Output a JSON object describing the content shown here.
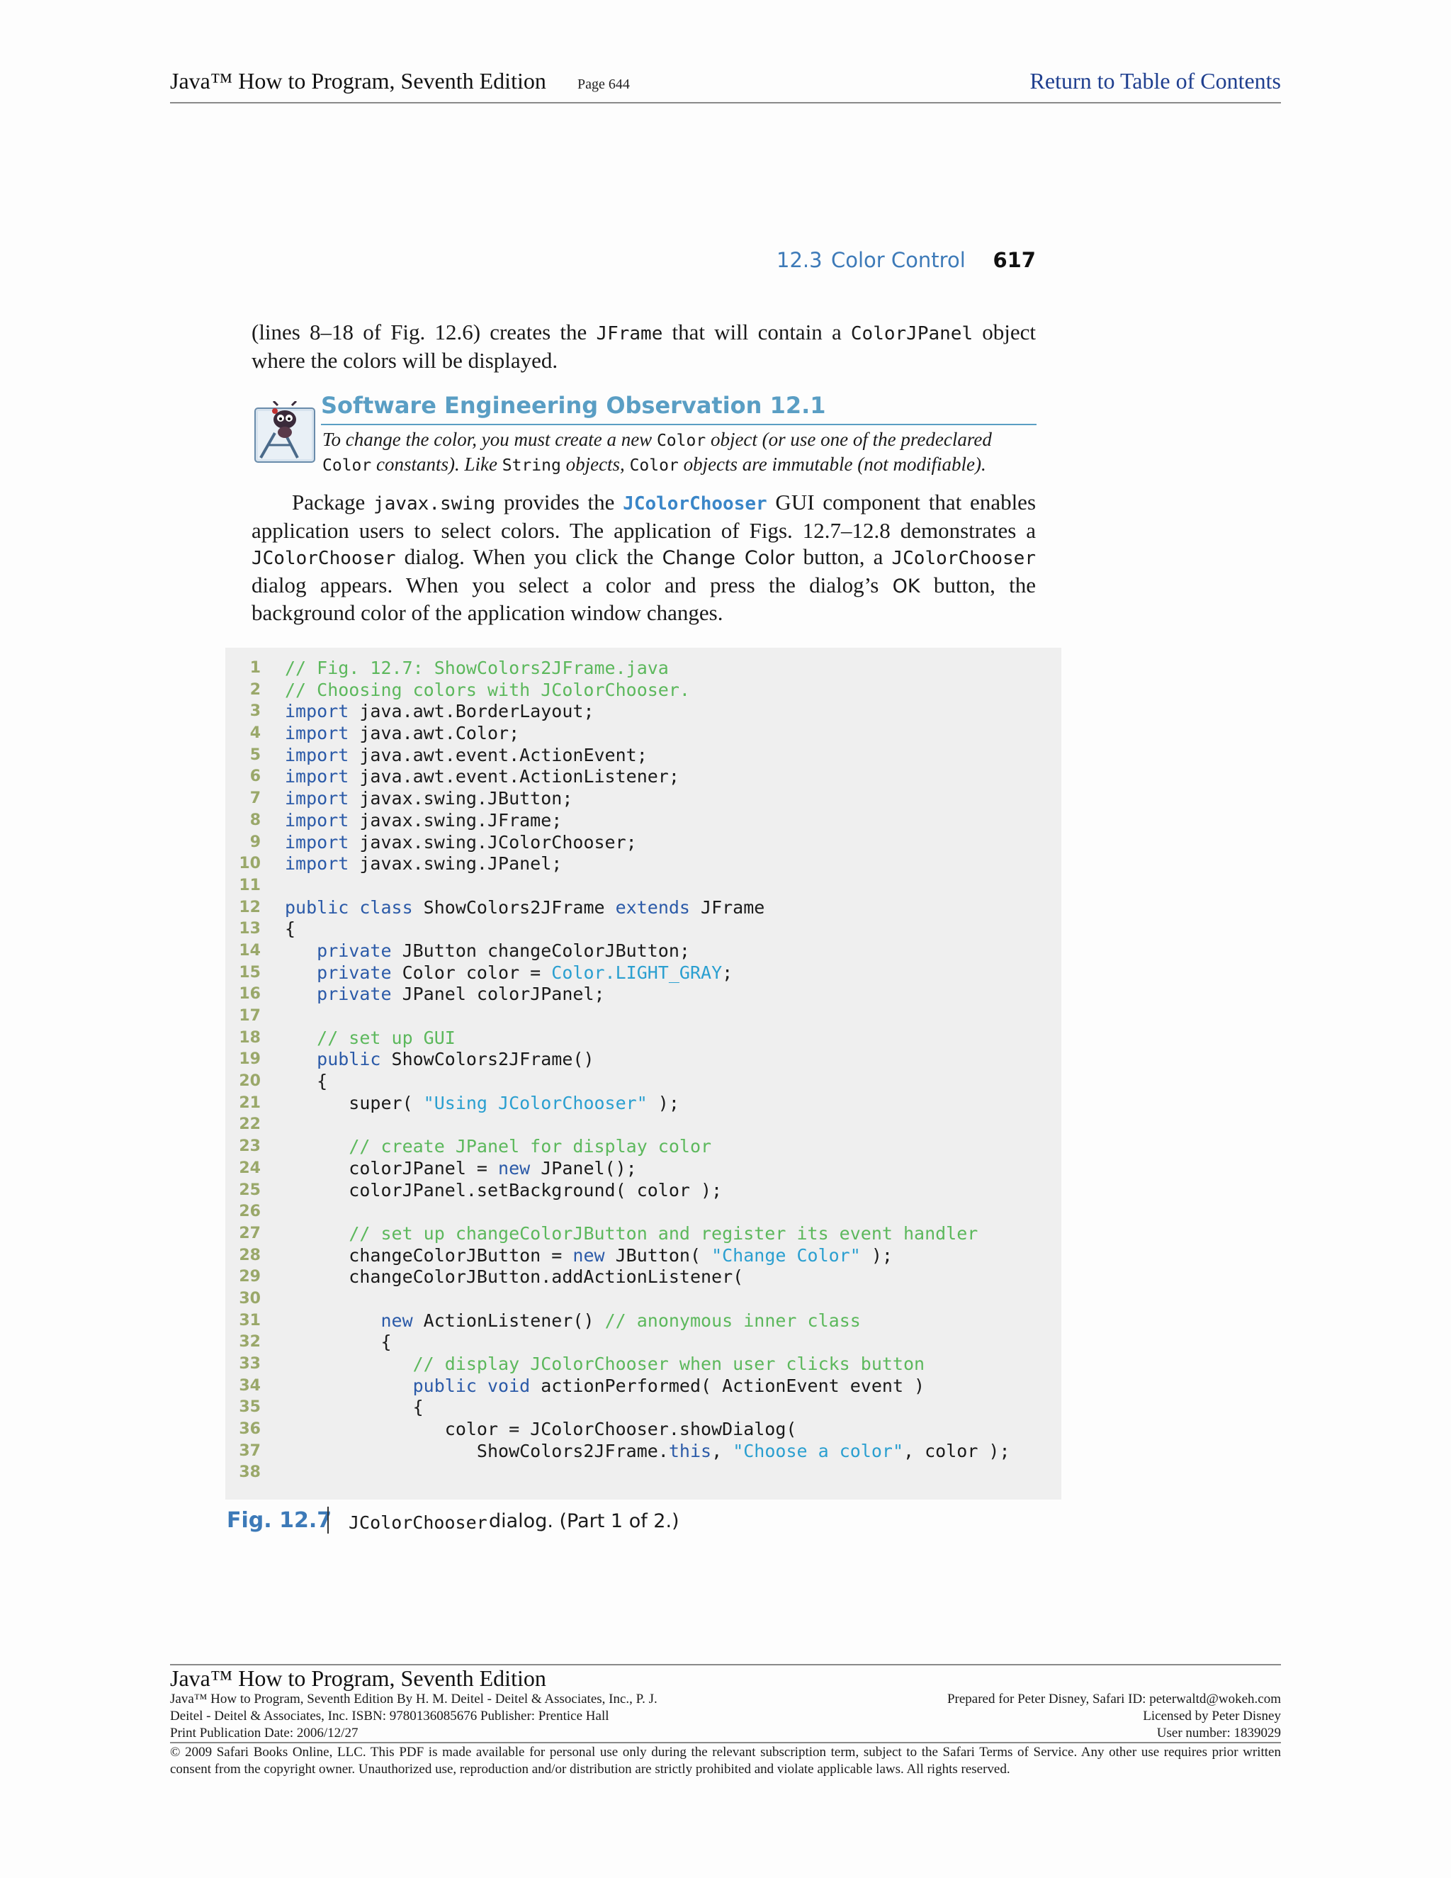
{
  "header": {
    "book_title": "Java™ How to Program, Seventh Edition",
    "page_label": "Page 644",
    "toc_link": "Return to Table of Contents"
  },
  "running_header": {
    "section_number": "12.3",
    "section_title": "Color Control",
    "page_number": "617"
  },
  "intro_paragraph": {
    "t1": "(lines 8–18 of Fig. 12.6) creates the ",
    "c1": "JFrame",
    "t2": " that will contain a ",
    "c2": "ColorJPanel",
    "t3": " object where the colors will be displayed."
  },
  "seo": {
    "title": "Software Engineering Observation 12.1",
    "t1": "To change the color, you must create a new ",
    "c1": "Color",
    "t2": " object (or use one of the predeclared ",
    "c2": "Color",
    "t3": " constants). Like ",
    "c3": "String",
    "t4": " objects, ",
    "c4": "Color",
    "t5": " objects are immutable (not modifiable)."
  },
  "main_paragraph": {
    "t1": "Package ",
    "c1": "javax.swing",
    "t2": " provides the ",
    "c2": "JColorChooser",
    "t3": " GUI component that enables application users to select colors. The application of Figs. 12.7–12.8 demonstrates a ",
    "c3": "JColorChooser",
    "t4": " dialog. When you click the ",
    "s1": "Change Color",
    "t5": " button, a ",
    "c4": "JColorChooser",
    "t6": " dialog appears. When you select a color and press the dialog’s ",
    "s2": "OK",
    "t7": " button, the background color of the application window changes."
  },
  "code": {
    "colors": {
      "comment": "#5cb85c",
      "keyword": "#2b5aa8",
      "string": "#2a9fd0",
      "constant": "#2a9fd0",
      "text": "#1a1a1a"
    },
    "lines": [
      {
        "n": "1",
        "segs": [
          [
            "comment",
            "// Fig. 12.7: ShowColors2JFrame.java"
          ]
        ]
      },
      {
        "n": "2",
        "segs": [
          [
            "comment",
            "// Choosing colors with JColorChooser."
          ]
        ]
      },
      {
        "n": "3",
        "segs": [
          [
            "keyword",
            "import"
          ],
          [
            "text",
            " java.awt.BorderLayout;"
          ]
        ]
      },
      {
        "n": "4",
        "segs": [
          [
            "keyword",
            "import"
          ],
          [
            "text",
            " java.awt.Color;"
          ]
        ]
      },
      {
        "n": "5",
        "segs": [
          [
            "keyword",
            "import"
          ],
          [
            "text",
            " java.awt.event.ActionEvent;"
          ]
        ]
      },
      {
        "n": "6",
        "segs": [
          [
            "keyword",
            "import"
          ],
          [
            "text",
            " java.awt.event.ActionListener;"
          ]
        ]
      },
      {
        "n": "7",
        "segs": [
          [
            "keyword",
            "import"
          ],
          [
            "text",
            " javax.swing.JButton;"
          ]
        ]
      },
      {
        "n": "8",
        "segs": [
          [
            "keyword",
            "import"
          ],
          [
            "text",
            " javax.swing.JFrame;"
          ]
        ]
      },
      {
        "n": "9",
        "segs": [
          [
            "keyword",
            "import"
          ],
          [
            "text",
            " javax.swing.JColorChooser;"
          ]
        ]
      },
      {
        "n": "10",
        "segs": [
          [
            "keyword",
            "import"
          ],
          [
            "text",
            " javax.swing.JPanel;"
          ]
        ]
      },
      {
        "n": "11",
        "segs": []
      },
      {
        "n": "12",
        "segs": [
          [
            "keyword",
            "public class"
          ],
          [
            "text",
            " ShowColors2JFrame "
          ],
          [
            "keyword",
            "extends"
          ],
          [
            "text",
            " JFrame"
          ]
        ]
      },
      {
        "n": "13",
        "segs": [
          [
            "text",
            "{"
          ]
        ]
      },
      {
        "n": "14",
        "segs": [
          [
            "text",
            "   "
          ],
          [
            "keyword",
            "private"
          ],
          [
            "text",
            " JButton changeColorJButton;"
          ]
        ]
      },
      {
        "n": "15",
        "segs": [
          [
            "text",
            "   "
          ],
          [
            "keyword",
            "private"
          ],
          [
            "text",
            " Color color = "
          ],
          [
            "constant",
            "Color.LIGHT_GRAY"
          ],
          [
            "text",
            ";"
          ]
        ]
      },
      {
        "n": "16",
        "segs": [
          [
            "text",
            "   "
          ],
          [
            "keyword",
            "private"
          ],
          [
            "text",
            " JPanel colorJPanel;"
          ]
        ]
      },
      {
        "n": "17",
        "segs": []
      },
      {
        "n": "18",
        "segs": [
          [
            "text",
            "   "
          ],
          [
            "comment",
            "// set up GUI"
          ]
        ]
      },
      {
        "n": "19",
        "segs": [
          [
            "text",
            "   "
          ],
          [
            "keyword",
            "public"
          ],
          [
            "text",
            " ShowColors2JFrame()"
          ]
        ]
      },
      {
        "n": "20",
        "segs": [
          [
            "text",
            "   {"
          ]
        ]
      },
      {
        "n": "21",
        "segs": [
          [
            "text",
            "      super( "
          ],
          [
            "string",
            "\"Using JColorChooser\""
          ],
          [
            "text",
            " );"
          ]
        ]
      },
      {
        "n": "22",
        "segs": []
      },
      {
        "n": "23",
        "segs": [
          [
            "text",
            "      "
          ],
          [
            "comment",
            "// create JPanel for display color"
          ]
        ]
      },
      {
        "n": "24",
        "segs": [
          [
            "text",
            "      colorJPanel = "
          ],
          [
            "keyword",
            "new"
          ],
          [
            "text",
            " JPanel();"
          ]
        ]
      },
      {
        "n": "25",
        "segs": [
          [
            "text",
            "      colorJPanel.setBackground( color );"
          ]
        ]
      },
      {
        "n": "26",
        "segs": []
      },
      {
        "n": "27",
        "segs": [
          [
            "text",
            "      "
          ],
          [
            "comment",
            "// set up changeColorJButton and register its event handler"
          ]
        ]
      },
      {
        "n": "28",
        "segs": [
          [
            "text",
            "      changeColorJButton = "
          ],
          [
            "keyword",
            "new"
          ],
          [
            "text",
            " JButton( "
          ],
          [
            "string",
            "\"Change Color\""
          ],
          [
            "text",
            " );"
          ]
        ]
      },
      {
        "n": "29",
        "segs": [
          [
            "text",
            "      changeColorJButton.addActionListener("
          ]
        ]
      },
      {
        "n": "30",
        "segs": []
      },
      {
        "n": "31",
        "segs": [
          [
            "text",
            "         "
          ],
          [
            "keyword",
            "new"
          ],
          [
            "text",
            " ActionListener() "
          ],
          [
            "comment",
            "// anonymous inner class"
          ]
        ]
      },
      {
        "n": "32",
        "segs": [
          [
            "text",
            "         {"
          ]
        ]
      },
      {
        "n": "33",
        "segs": [
          [
            "text",
            "            "
          ],
          [
            "comment",
            "// display JColorChooser when user clicks button"
          ]
        ]
      },
      {
        "n": "34",
        "segs": [
          [
            "text",
            "            "
          ],
          [
            "keyword",
            "public void"
          ],
          [
            "text",
            " actionPerformed( ActionEvent event )"
          ]
        ]
      },
      {
        "n": "35",
        "segs": [
          [
            "text",
            "            {"
          ]
        ]
      },
      {
        "n": "36",
        "segs": [
          [
            "text",
            "               color = JColorChooser.showDialog("
          ]
        ]
      },
      {
        "n": "37",
        "segs": [
          [
            "text",
            "                  ShowColors2JFrame."
          ],
          [
            "keyword",
            "this"
          ],
          [
            "text",
            ", "
          ],
          [
            "string",
            "\"Choose a color\""
          ],
          [
            "text",
            ", color );"
          ]
        ]
      },
      {
        "n": "38",
        "segs": []
      }
    ]
  },
  "caption": {
    "label": "Fig. 12.7",
    "code": "JColorChooser",
    "text": "dialog. (Part 1 of 2.)"
  },
  "footer": {
    "title": "Java™ How to Program, Seventh Edition",
    "left_lines": [
      "Java™ How to Program, Seventh Edition By H. M. Deitel - Deitel & Associates, Inc., P. J.",
      "Deitel - Deitel & Associates, Inc. ISBN: 9780136085676 Publisher: Prentice Hall",
      "Print Publication Date: 2006/12/27"
    ],
    "right_lines": [
      "Prepared for Peter Disney, Safari ID: peterwaltd@wokeh.com",
      "Licensed by Peter Disney",
      "User number: 1839029"
    ],
    "copyright": "© 2009 Safari Books Online, LLC. This PDF is made available for personal use only during the relevant subscription term, subject to the Safari Terms of Service. Any other use requires prior written consent from the copyright owner. Unauthorized use, reproduction and/or distribution are strictly prohibited and violate applicable laws. All rights reserved."
  }
}
